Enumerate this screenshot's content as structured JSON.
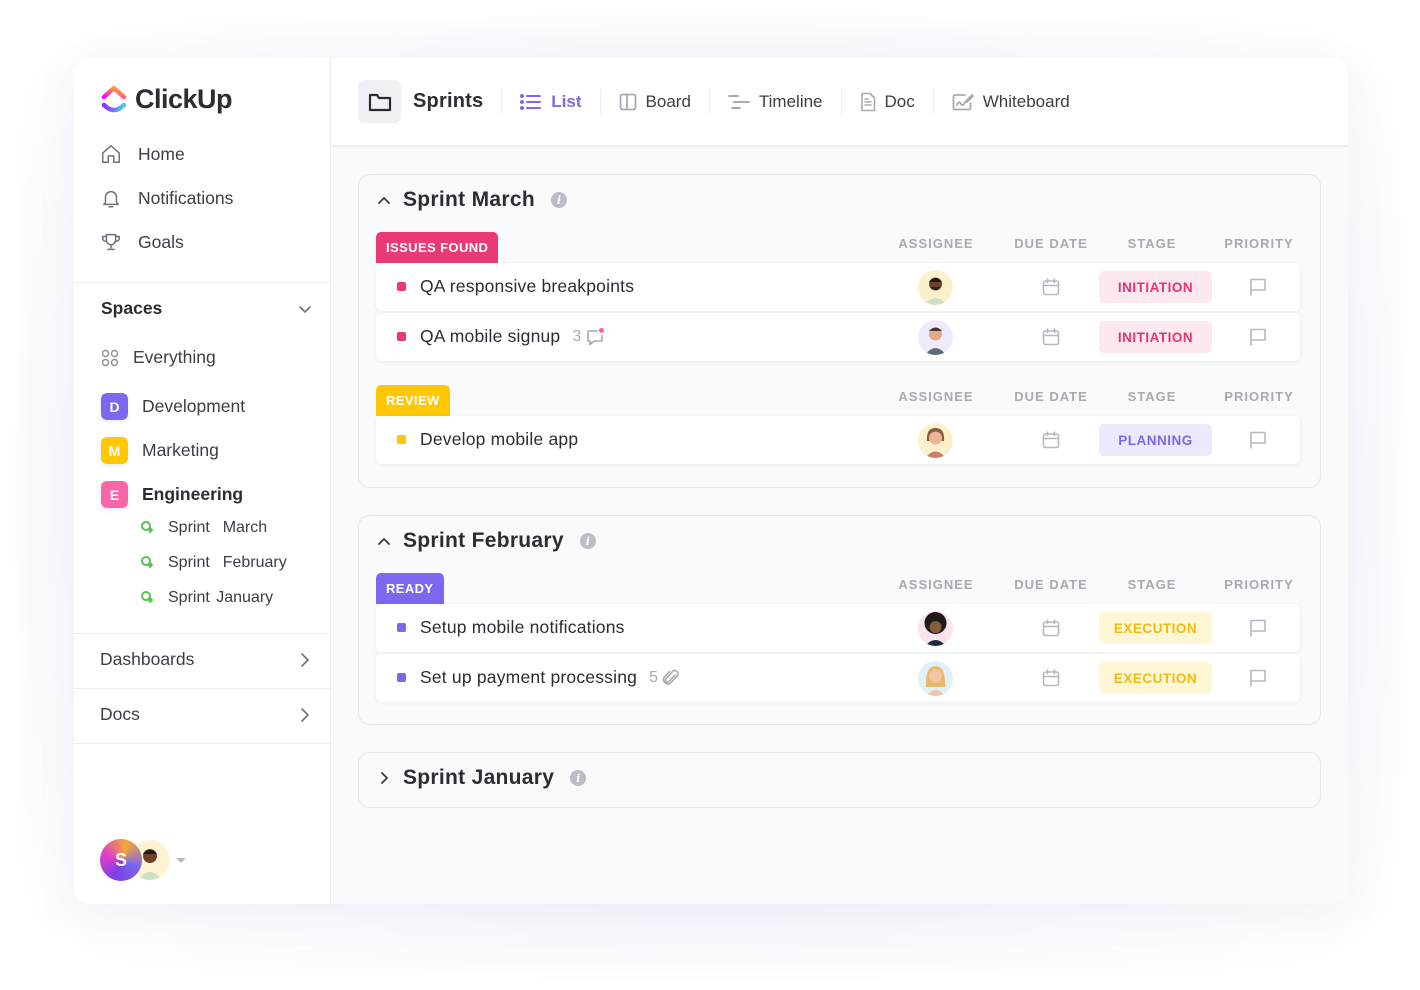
{
  "app": {
    "name": "ClickUp"
  },
  "sidebar": {
    "nav": [
      {
        "label": "Home",
        "icon": "home-icon"
      },
      {
        "label": "Notifications",
        "icon": "bell-icon"
      },
      {
        "label": "Goals",
        "icon": "trophy-icon"
      }
    ],
    "spaces_label": "Spaces",
    "everything_label": "Everything",
    "spaces": [
      {
        "letter": "D",
        "label": "Development",
        "color": "#7b68ee"
      },
      {
        "letter": "M",
        "label": "Marketing",
        "color": "#ffc800"
      },
      {
        "letter": "E",
        "label": "Engineering",
        "color": "#f767a8"
      }
    ],
    "sprint_lists": [
      {
        "label": "Sprint  March"
      },
      {
        "label": "Sprint  February"
      },
      {
        "label": "Sprint January"
      }
    ],
    "dashboards_label": "Dashboards",
    "docs_label": "Docs",
    "user_initial": "S"
  },
  "topbar": {
    "title": "Sprints",
    "views": [
      {
        "label": "List",
        "icon": "list-icon",
        "active": true
      },
      {
        "label": "Board",
        "icon": "board-icon",
        "active": false
      },
      {
        "label": "Timeline",
        "icon": "timeline-icon",
        "active": false
      },
      {
        "label": "Doc",
        "icon": "doc-icon",
        "active": false
      },
      {
        "label": "Whiteboard",
        "icon": "whiteboard-icon",
        "active": false
      }
    ]
  },
  "columns": {
    "assignee": "ASSIGNEE",
    "due_date": "DUE DATE",
    "stage": "STAGE",
    "priority": "PRIORITY"
  },
  "sprints": [
    {
      "title": "Sprint March",
      "expanded": true,
      "groups": [
        {
          "status": "ISSUES FOUND",
          "color": "#ea3a76",
          "tasks": [
            {
              "name": "QA responsive breakpoints",
              "meta": null,
              "stage": "INITIATION",
              "stage_color": "#e8336f",
              "stage_bg": "#fde8ef",
              "avatar_bg": "#fdf0cc"
            },
            {
              "name": "QA mobile signup",
              "meta": {
                "count": "3",
                "icon": "comment-icon"
              },
              "stage": "INITIATION",
              "stage_color": "#e8336f",
              "stage_bg": "#fde8ef",
              "avatar_bg": "#efeafb"
            }
          ]
        },
        {
          "status": "REVIEW",
          "color": "#ffc800",
          "tasks": [
            {
              "name": "Develop mobile app",
              "meta": null,
              "stage": "PLANNING",
              "stage_color": "#7b68ee",
              "stage_bg": "#ece9fc",
              "avatar_bg": "#fdf0cc"
            }
          ]
        }
      ]
    },
    {
      "title": "Sprint February",
      "expanded": true,
      "groups": [
        {
          "status": "READY",
          "color": "#7b68ee",
          "tasks": [
            {
              "name": "Setup mobile notifications",
              "meta": null,
              "stage": "EXECUTION",
              "stage_color": "#f2bb0b",
              "stage_bg": "#fff6d6",
              "avatar_bg": "#fde4ec"
            },
            {
              "name": "Set up payment processing",
              "meta": {
                "count": "5",
                "icon": "paperclip-icon"
              },
              "stage": "EXECUTION",
              "stage_color": "#f2bb0b",
              "stage_bg": "#fff6d6",
              "avatar_bg": "#dff2fb"
            }
          ]
        }
      ]
    },
    {
      "title": "Sprint January",
      "expanded": false,
      "groups": []
    }
  ]
}
